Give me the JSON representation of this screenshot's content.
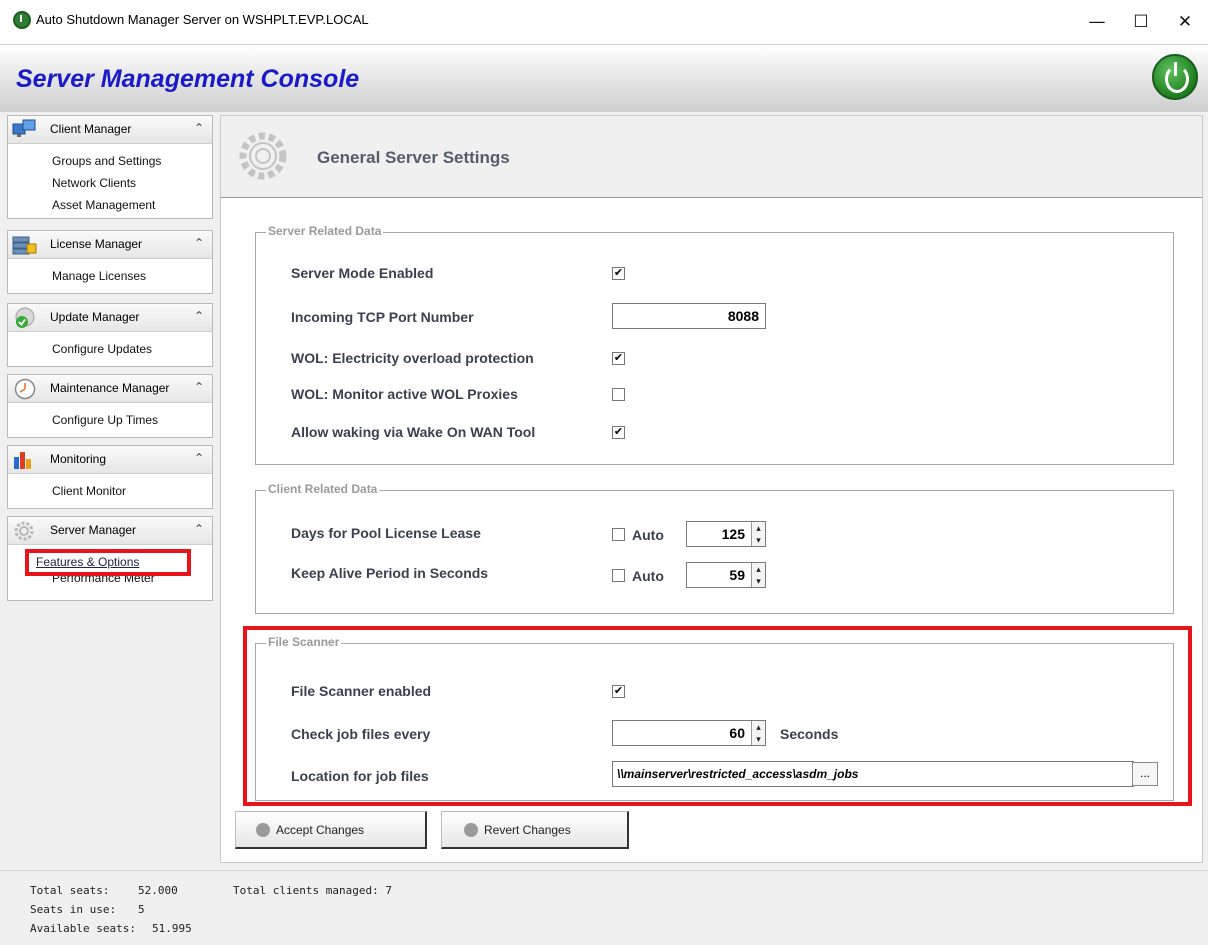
{
  "window": {
    "title": "Auto Shutdown Manager Server on WSHPLT.EVP.LOCAL",
    "minimize": "—",
    "maximize": "☐",
    "close": "✕"
  },
  "header": {
    "title": "Server Management Console"
  },
  "sidebar": {
    "groups": [
      {
        "label": "Client Manager",
        "icon": "client-manager-icon",
        "items": [
          "Groups and Settings",
          "Network Clients",
          "Asset Management"
        ]
      },
      {
        "label": "License Manager",
        "icon": "license-manager-icon",
        "items": [
          "Manage Licenses"
        ]
      },
      {
        "label": "Update  Manager",
        "icon": "update-manager-icon",
        "items": [
          "Configure Updates"
        ]
      },
      {
        "label": "Maintenance Manager",
        "icon": "maintenance-clock-icon",
        "items": [
          "Configure Up Times"
        ]
      },
      {
        "label": "Monitoring",
        "icon": "monitoring-chart-icon",
        "items": [
          "Client Monitor"
        ]
      },
      {
        "label": "Server Manager",
        "icon": "server-manager-gear-icon",
        "items": [
          "Features & Options",
          "Performance Meter"
        ]
      }
    ],
    "collapse_glyph": "⌃"
  },
  "page": {
    "title": "General Server Settings",
    "server_related": {
      "title": "Server Related Data",
      "server_mode_label": "Server Mode Enabled",
      "server_mode_checked": true,
      "tcp_port_label": "Incoming TCP Port Number",
      "tcp_port_value": "8088",
      "wol_overload_label": "WOL: Electricity overload protection",
      "wol_overload_checked": true,
      "wol_proxies_label": "WOL: Monitor active WOL Proxies",
      "wol_proxies_checked": false,
      "wake_on_wan_label": "Allow waking via Wake On WAN Tool",
      "wake_on_wan_checked": true
    },
    "client_related": {
      "title": "Client Related Data",
      "pool_lease_label": "Days for Pool License Lease",
      "pool_lease_auto_label": "Auto",
      "pool_lease_auto_checked": false,
      "pool_lease_value": "125",
      "keep_alive_label": "Keep Alive Period in Seconds",
      "keep_alive_auto_label": "Auto",
      "keep_alive_auto_checked": false,
      "keep_alive_value": "59"
    },
    "file_scanner": {
      "title": "File Scanner",
      "enabled_label": "File Scanner enabled",
      "enabled_checked": true,
      "check_every_label": "Check job files every",
      "check_every_value": "60",
      "check_every_unit": "Seconds",
      "location_label": "Location for job files",
      "location_value": "\\\\mainserver\\restricted_access\\asdm_jobs",
      "browse_label": "..."
    },
    "buttons": {
      "accept": "Accept Changes",
      "revert": "Revert Changes"
    }
  },
  "status": {
    "total_seats_label": "Total seats:",
    "total_seats_value": "52.000",
    "seats_in_use_label": "Seats in use:",
    "seats_in_use_value": "5",
    "available_seats_label": "Available seats:",
    "available_seats_value": "51.995",
    "total_clients": "Total clients managed: 7"
  },
  "colors": {
    "highlight": "#e8141c",
    "header_title": "#1a1ac8",
    "label": "#3c4150"
  },
  "checkmark": "✔"
}
